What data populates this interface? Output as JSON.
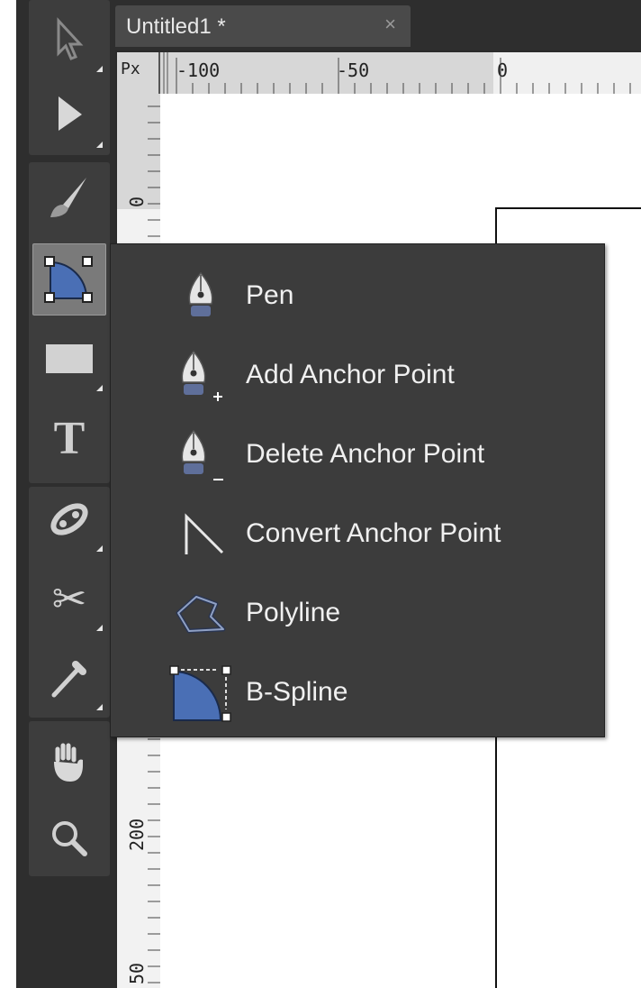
{
  "document_tab": {
    "title": "Untitled1 *",
    "close": "×"
  },
  "ruler": {
    "unit": "Px",
    "top_labels": [
      "-100",
      "-50",
      "0"
    ],
    "left_labels": [
      "0",
      "200",
      "50"
    ]
  },
  "toolbar": {
    "tools": [
      {
        "name": "subselect-tool",
        "icon": "hollow-arrow-icon"
      },
      {
        "name": "select-tool",
        "icon": "arrow-icon"
      },
      {
        "name": "brush-tool",
        "icon": "brush-icon"
      },
      {
        "name": "bspline-tool",
        "icon": "bspline-icon",
        "active": true
      },
      {
        "name": "rectangle-tool",
        "icon": "rectangle-icon"
      },
      {
        "name": "text-tool",
        "icon": "text-icon",
        "glyph": "T"
      },
      {
        "name": "blend-tool",
        "icon": "blend-icon"
      },
      {
        "name": "scissors-tool",
        "icon": "scissors-icon",
        "glyph": "✂"
      },
      {
        "name": "eyedropper-tool",
        "icon": "eyedropper-icon"
      },
      {
        "name": "hand-tool",
        "icon": "hand-icon"
      },
      {
        "name": "zoom-tool",
        "icon": "zoom-icon"
      }
    ]
  },
  "flyout": {
    "items": [
      {
        "label": "Pen",
        "icon": "pen-icon"
      },
      {
        "label": "Add Anchor Point",
        "icon": "pen-add-icon"
      },
      {
        "label": "Delete Anchor Point",
        "icon": "pen-delete-icon"
      },
      {
        "label": "Convert Anchor Point",
        "icon": "convert-anchor-icon"
      },
      {
        "label": "Polyline",
        "icon": "polyline-icon"
      },
      {
        "label": "B-Spline",
        "icon": "bspline-icon"
      }
    ]
  },
  "colors": {
    "panel": "#2e2e2e",
    "menu": "#3c3c3c",
    "accent_blue": "#4a6fb5",
    "ruler": "#d7d7d7"
  }
}
